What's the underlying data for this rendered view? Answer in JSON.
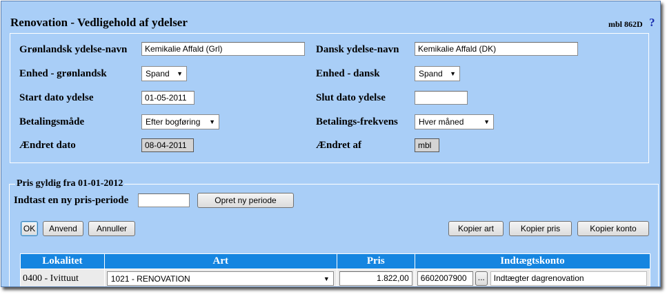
{
  "header": {
    "title": "Renovation - Vedligehold af ydelser",
    "code": "mbl 862D",
    "help": "?"
  },
  "form": {
    "gl_name_label": "Grønlandsk ydelse-navn",
    "gl_name_value": "Kemikalie Affald (Grl)",
    "dk_name_label": "Dansk ydelse-navn",
    "dk_name_value": "Kemikalie Affald (DK)",
    "unit_gl_label": "Enhed - grønlandsk",
    "unit_gl_value": "Spand",
    "unit_dk_label": "Enhed - dansk",
    "unit_dk_value": "Spand",
    "start_label": "Start dato ydelse",
    "start_value": "01-05-2011",
    "end_label": "Slut dato ydelse",
    "end_value": "",
    "payment_label": "Betalingsmåde",
    "payment_value": "Efter bogføring",
    "freq_label": "Betalings-frekvens",
    "freq_value": "Hver måned",
    "changed_date_label": "Ændret dato",
    "changed_date_value": "08-04-2011",
    "changed_by_label": "Ændret af",
    "changed_by_value": "mbl"
  },
  "price": {
    "legend": "Pris gyldig fra 01-01-2012",
    "new_period_label": "Indtast en ny pris-periode",
    "new_period_value": "",
    "create_button": "Opret ny periode"
  },
  "actions": {
    "ok": "OK",
    "apply": "Anvend",
    "cancel": "Annuller",
    "copy_art": "Kopier art",
    "copy_price": "Kopier pris",
    "copy_account": "Kopier konto"
  },
  "table": {
    "headers": [
      "Lokalitet",
      "Art",
      "Pris",
      "Indtægtskonto"
    ],
    "rows": [
      {
        "location": "0400 - Ivittuut",
        "art": "1021 - RENOVATION",
        "price": "1.822,00",
        "account": "6602007900",
        "lookup": "...",
        "account_desc": "Indtægter dagrenovation"
      }
    ]
  }
}
